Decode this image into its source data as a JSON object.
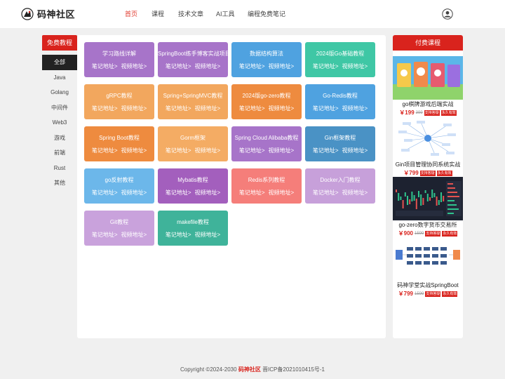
{
  "brand": {
    "name": "码神社区"
  },
  "nav": [
    {
      "label": "首页",
      "active": true
    },
    {
      "label": "课程",
      "active": false
    },
    {
      "label": "技术文章",
      "active": false
    },
    {
      "label": "AI工具",
      "active": false
    },
    {
      "label": "编程免费笔记",
      "active": false
    }
  ],
  "free": {
    "title": "免费教程",
    "categories": [
      "全部",
      "Java",
      "Golang",
      "中间件",
      "Web3",
      "游戏",
      "前端",
      "Rust",
      "其他"
    ],
    "note_label": "笔记地址>",
    "video_label": "视频地址>",
    "cards": [
      {
        "title": "学习路线详解",
        "color": "#a774c9"
      },
      {
        "title": "SpringBoot练手博客实战项目",
        "color": "#a774c9"
      },
      {
        "title": "数据结构算法",
        "color": "#4fa2e0"
      },
      {
        "title": "2024版Go基础教程",
        "color": "#3fc7a5"
      },
      {
        "title": "gRPC教程",
        "color": "#f2a75e"
      },
      {
        "title": "Spring+SpringMVC教程",
        "color": "#f2a75e"
      },
      {
        "title": "2024版go-zero教程",
        "color": "#ee8b3f"
      },
      {
        "title": "Go-Redis教程",
        "color": "#4fa2e0"
      },
      {
        "title": "Spring Boot教程",
        "color": "#ee8b3f"
      },
      {
        "title": "Gorm框架",
        "color": "#f4ac64"
      },
      {
        "title": "Spring Cloud Alibaba教程",
        "color": "#a774c9"
      },
      {
        "title": "Gin框架教程",
        "color": "#4a92c5"
      },
      {
        "title": "go反射教程",
        "color": "#6cb7ea"
      },
      {
        "title": "Mybatis教程",
        "color": "#a35fbd"
      },
      {
        "title": "Redis系列教程",
        "color": "#f57e7a"
      },
      {
        "title": "Docker入门教程",
        "color": "#c7a0da"
      },
      {
        "title": "Git教程",
        "color": "#c9a2dc"
      },
      {
        "title": "makefile教程",
        "color": "#3fb39a"
      }
    ]
  },
  "paid": {
    "title": "付费课程",
    "courses": [
      {
        "name": "go棋牌游戏后端实战",
        "price": "￥199",
        "old_price": "399",
        "tags": [
          "支持答疑",
          "永久有效"
        ],
        "thumb": "game"
      },
      {
        "name": "Gin项目管理协同系统实战",
        "price": "￥799",
        "old_price": "",
        "tags": [
          "支持答疑",
          "永久有效"
        ],
        "thumb": "mindmap"
      },
      {
        "name": "go-zero数字货币交易所",
        "price": "￥900",
        "old_price": "1599",
        "tags": [
          "支持答疑",
          "永久有效"
        ],
        "thumb": "trading"
      },
      {
        "name": "码神学堂实战SpringBoot",
        "price": "￥799",
        "old_price": "1599",
        "tags": [
          "支持答疑",
          "永久有效"
        ],
        "thumb": "flow"
      }
    ]
  },
  "footer": {
    "copyright": "Copyright ©2024-2030",
    "brand": "码神社区",
    "icp": "晋ICP备2021010415号-1"
  },
  "colors": {
    "accent": "#d9231d",
    "nav_active": "#e03a2e"
  }
}
